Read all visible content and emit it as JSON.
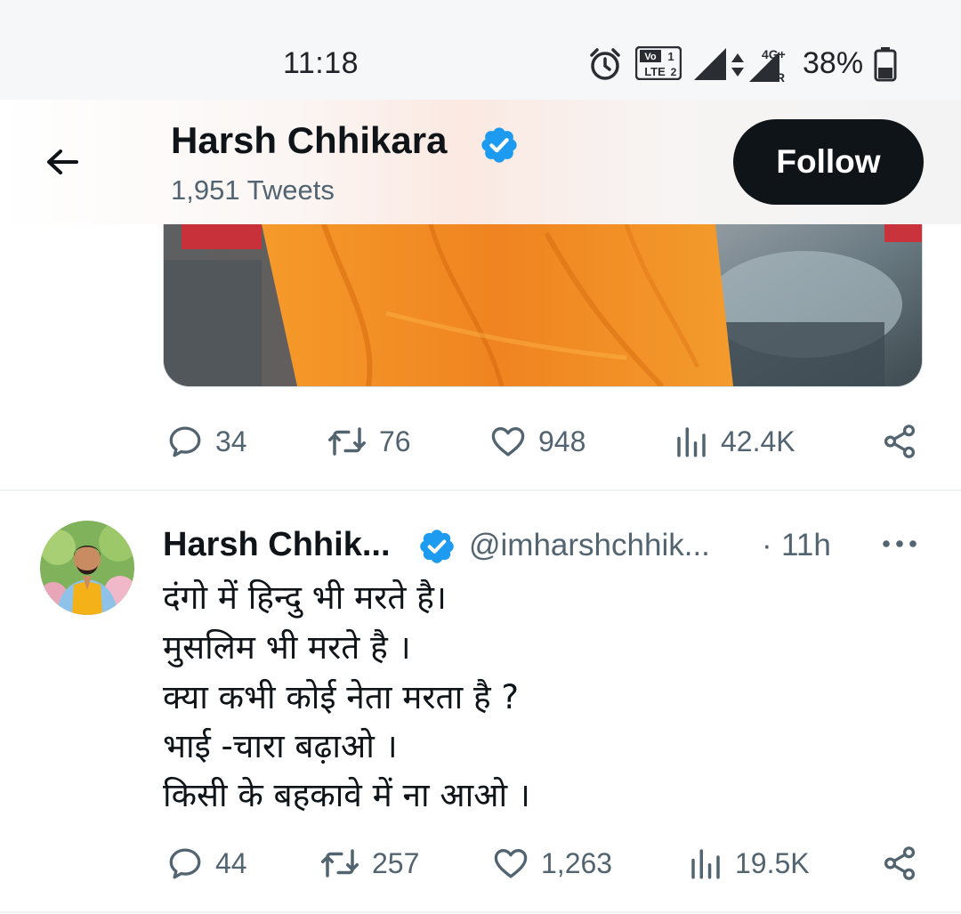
{
  "status_bar": {
    "time": "11:18",
    "battery_percent": "38%",
    "icons": [
      "alarm-icon",
      "volte-icon",
      "signal-icon",
      "4g-signal-icon",
      "battery-icon"
    ],
    "network_label": "4G+"
  },
  "header": {
    "name": "Harsh Chhikara",
    "tweet_count": "1,951 Tweets",
    "follow_label": "Follow",
    "verified": true
  },
  "tweets": [
    {
      "actions": {
        "replies": "34",
        "retweets": "76",
        "likes": "948",
        "views": "42.4K"
      }
    },
    {
      "author_name": "Harsh Chhik...",
      "handle": "@imharshchhik...",
      "separator": "·",
      "time": "11h",
      "lines": [
        "दंगो में हिन्दु भी मरते है।",
        "मुसलिम भी मरते है ।",
        "क्या कभी कोई नेता मरता है ?",
        "भाई -चारा बढ़ाओ ।",
        "किसी के बहकावे में ना आओ ।"
      ],
      "actions": {
        "replies": "44",
        "retweets": "257",
        "likes": "1,263",
        "views": "19.5K"
      }
    }
  ],
  "colors": {
    "text_primary": "#0f1419",
    "text_secondary": "#536471",
    "verified_blue": "#1d9bf0",
    "follow_bg": "#0f1419",
    "robe_orange": "#f28a1e"
  }
}
